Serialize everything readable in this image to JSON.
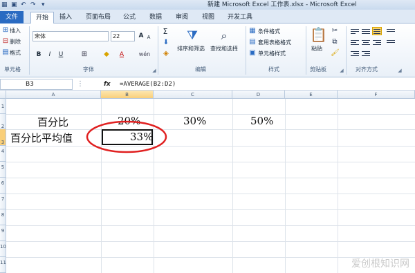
{
  "window": {
    "title": "新建 Microsoft Excel 工作表.xlsx - Microsoft Excel"
  },
  "tabs": [
    {
      "label": "文件"
    },
    {
      "label": "开始"
    },
    {
      "label": "插入"
    },
    {
      "label": "页面布局"
    },
    {
      "label": "公式"
    },
    {
      "label": "数据"
    },
    {
      "label": "审阅"
    },
    {
      "label": "视图"
    },
    {
      "label": "开发工具"
    }
  ],
  "ribbon": {
    "cells_group": {
      "insert": "插入",
      "delete": "删除",
      "format": "格式",
      "label": "单元格"
    },
    "font_group": {
      "font_name": "宋体",
      "font_size": "22",
      "label": "字体",
      "bold": "B",
      "italic": "I",
      "underline": "U",
      "grow": "A",
      "shrink": "A",
      "font_color_glyph": "A",
      "phonetic": "wén"
    },
    "editing_group": {
      "sigma": "Σ",
      "sort_filter": "排序和筛选",
      "find_select": "查找和选择",
      "label": "编辑"
    },
    "styles_group": {
      "conditional": "条件格式",
      "table_format": "套用表格格式",
      "cell_styles": "单元格样式",
      "label": "样式"
    },
    "clipboard_group": {
      "paste": "粘贴",
      "label": "剪贴板"
    },
    "alignment_group": {
      "label": "对齐方式"
    }
  },
  "formula_bar": {
    "name_box": "B3",
    "fx": "fx",
    "formula": "=AVERAGE(B2:D2)"
  },
  "grid": {
    "columns": [
      "A",
      "B",
      "C",
      "D",
      "E",
      "F"
    ],
    "rows": [
      "1",
      "2",
      "3",
      "4",
      "5",
      "6",
      "7",
      "8",
      "9",
      "10",
      "11"
    ],
    "selected_cell": "B3",
    "cells": {
      "A2": "百分比",
      "B2": "20%",
      "C2": "30%",
      "D2": "50%",
      "A3": "百分比平均值",
      "B3": "33%"
    }
  },
  "annotation": {
    "shape": "ellipse",
    "color": "#e02020"
  },
  "watermark": "爱创根知识网"
}
